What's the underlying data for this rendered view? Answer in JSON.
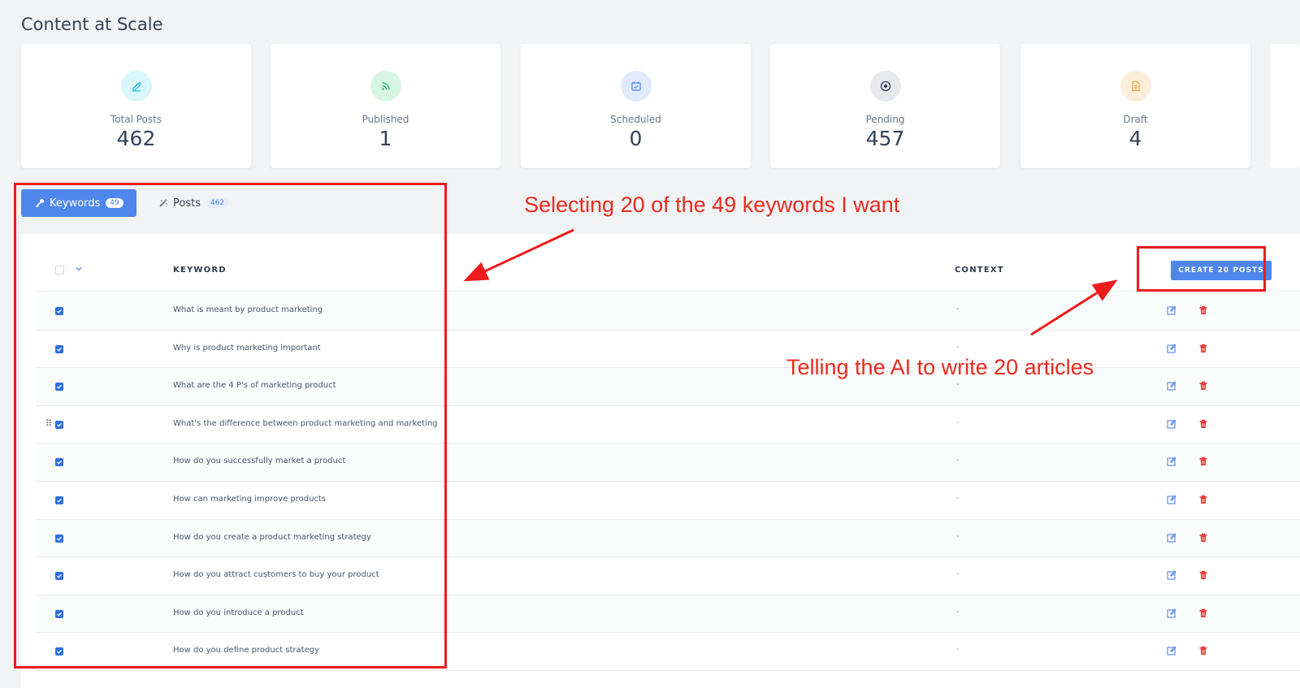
{
  "page": {
    "title": "Content at Scale"
  },
  "stats": [
    {
      "label": "Total Posts",
      "value": "462",
      "icon": "pencil-icon",
      "color": "#2bc4d8",
      "bg": "#d9f6fa"
    },
    {
      "label": "Published",
      "value": "1",
      "icon": "rss-icon",
      "color": "#2fbf71",
      "bg": "#d8f6e4"
    },
    {
      "label": "Scheduled",
      "value": "0",
      "icon": "calendar-check-icon",
      "color": "#4f86ec",
      "bg": "#e1eafb"
    },
    {
      "label": "Pending",
      "value": "457",
      "icon": "record-icon",
      "color": "#344256",
      "bg": "#e7e9ec"
    },
    {
      "label": "Draft",
      "value": "4",
      "icon": "document-icon",
      "color": "#f2a33a",
      "bg": "#fdeedb"
    }
  ],
  "tabs": {
    "keywords": {
      "label": "Keywords",
      "count": "49"
    },
    "posts": {
      "label": "Posts",
      "count": "462"
    }
  },
  "table": {
    "headers": {
      "keyword": "KEYWORD",
      "context": "CONTEXT"
    },
    "create_button": "CREATE 20 POSTS",
    "rows": [
      {
        "keyword": "What is meant by product marketing",
        "context": "-",
        "checked": true
      },
      {
        "keyword": "Why is product marketing important",
        "context": "-",
        "checked": true
      },
      {
        "keyword": "What are the 4 P's of marketing product",
        "context": "-",
        "checked": true
      },
      {
        "keyword": "What's the difference between product marketing and marketing",
        "context": "-",
        "checked": true
      },
      {
        "keyword": "How do you successfully market a product",
        "context": "-",
        "checked": true
      },
      {
        "keyword": "How can marketing improve products",
        "context": "-",
        "checked": true
      },
      {
        "keyword": "How do you create a product marketing strategy",
        "context": "-",
        "checked": true
      },
      {
        "keyword": "How do you attract customers to buy your product",
        "context": "-",
        "checked": true
      },
      {
        "keyword": "How do you introduce a product",
        "context": "-",
        "checked": true
      },
      {
        "keyword": "How do you define product strategy",
        "context": "-",
        "checked": true
      }
    ]
  },
  "annotations": {
    "selecting": "Selecting 20 of the 49 keywords I want",
    "telling": "Telling the AI to write 20 articles",
    "color": "#ec1c1c"
  }
}
